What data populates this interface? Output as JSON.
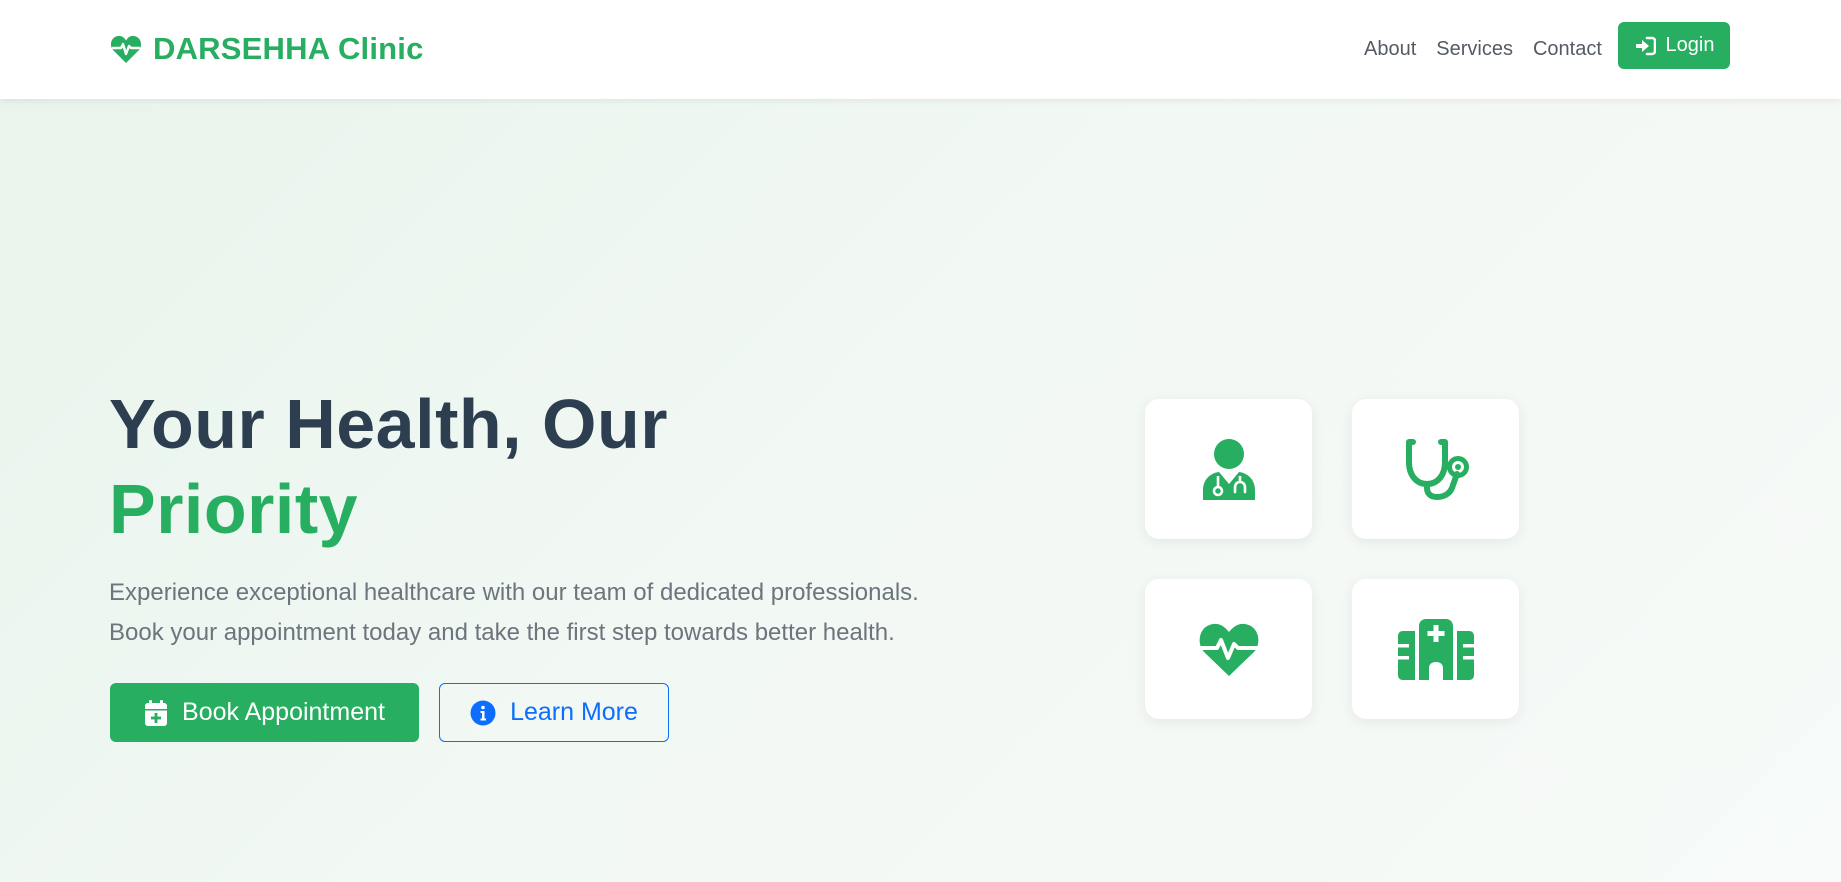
{
  "colors": {
    "primary": "#27ae60",
    "heading": "#2c3e50",
    "text_muted": "#6c757d",
    "outline_blue": "#0d6efd"
  },
  "navbar": {
    "brand_icon": "heart-pulse-icon",
    "brand_name": "DARSEHHA Clinic",
    "links": [
      {
        "label": "About"
      },
      {
        "label": "Services"
      },
      {
        "label": "Contact"
      }
    ],
    "login": {
      "icon": "sign-in-icon",
      "label": "Login"
    }
  },
  "hero": {
    "headline_line1": "Your Health, Our",
    "headline_line2": "Priority",
    "lead_line1": "Experience exceptional healthcare with our team of dedicated professionals.",
    "lead_line2": "Book your appointment today and take the first step towards better health.",
    "primary_button": {
      "icon": "calendar-plus-icon",
      "label": "Book Appointment"
    },
    "secondary_button": {
      "icon": "info-circle-icon",
      "label": "Learn More"
    }
  },
  "feature_cards": [
    {
      "icon": "user-doctor-icon"
    },
    {
      "icon": "stethoscope-icon"
    },
    {
      "icon": "heart-pulse-icon"
    },
    {
      "icon": "hospital-icon"
    }
  ]
}
